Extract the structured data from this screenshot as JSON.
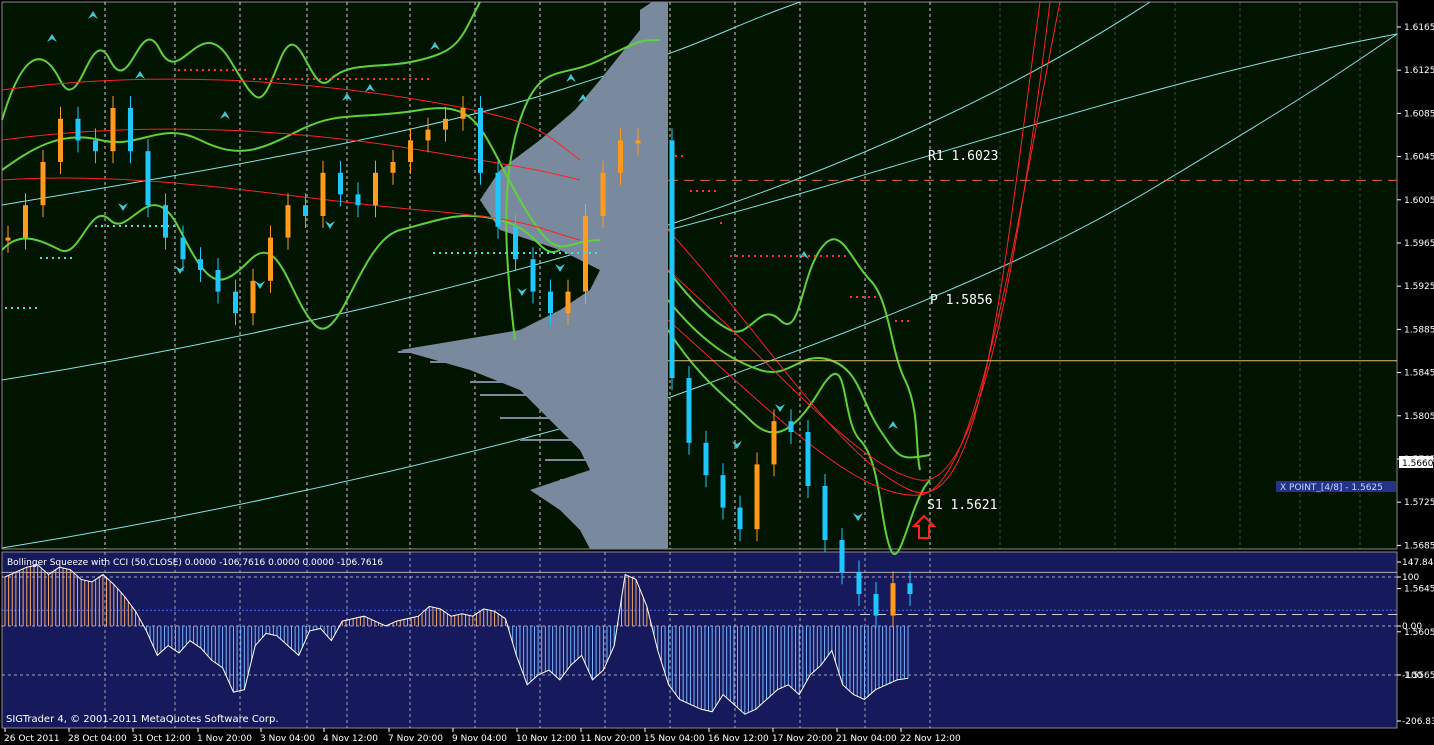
{
  "main_panel": {
    "price_axis_ticks": [
      "1.6165",
      "1.6125",
      "1.6085",
      "1.6045",
      "1.6005",
      "1.5965",
      "1.5925",
      "1.5885",
      "1.5845",
      "1.5805",
      "1.5765",
      "1.5725",
      "1.5685",
      "1.5645",
      "1.5605",
      "1.5565"
    ],
    "current_price": "1.5660",
    "pivot_R1": "R1  1.6023",
    "pivot_P": "P  1.5856",
    "pivot_S1": "S1  1.5621",
    "xpoint_label": "X POINT_[4/8] - 1.5625",
    "colors": {
      "background": "#001400",
      "bull_candle": "#ff9a1e",
      "bear_candle": "#1ec8ff",
      "bands": "#5ed13c",
      "regression": "#ff2020",
      "channel": "#7fe6ec",
      "profile": "#7a8a9e",
      "pivot_line_r1": "#e0603a",
      "pivot_line_p": "#e8c070",
      "arrow": "#ff2020"
    }
  },
  "indicator_panel": {
    "title": "Bollinger Squeeze with CCI (50,CLOSE) 0.0000 -106.7616 0.0000 0.0000 -106.7616",
    "axis_ticks": [
      "147.841",
      "100",
      "0.00",
      "-100",
      "-206.836"
    ],
    "copyright": "SIGTrader 4, © 2001-2011 MetaQuotes Software Corp.",
    "colors": {
      "background": "#161a5c",
      "pos_hist": "#f0a86a",
      "neg_hist": "#7ab4ff",
      "line": "#ffffff"
    }
  },
  "x_axis_labels": [
    "26 Oct 2011",
    "28 Oct 04:00",
    "31 Oct 12:00",
    "1 Nov 20:00",
    "3 Nov 04:00",
    "4 Nov 12:00",
    "7 Nov 20:00",
    "9 Nov 04:00",
    "10 Nov 12:00",
    "11 Nov 20:00",
    "15 Nov 04:00",
    "16 Nov 12:00",
    "17 Nov 20:00",
    "21 Nov 04:00",
    "22 Nov 12:00"
  ],
  "chart_data": {
    "type": "candlestick",
    "symbol_pair_price_range": [
      1.5545,
      1.6185
    ],
    "close_path": [
      1.597,
      1.6,
      1.604,
      1.608,
      1.606,
      1.605,
      1.609,
      1.605,
      1.6,
      1.597,
      1.595,
      1.594,
      1.592,
      1.59,
      1.593,
      1.597,
      1.6,
      1.599,
      1.603,
      1.601,
      1.6,
      1.603,
      1.604,
      1.606,
      1.607,
      1.608,
      1.609,
      1.603,
      1.598,
      1.595,
      1.592,
      1.59,
      1.592,
      1.599,
      1.603,
      1.606,
      1.606,
      1.584,
      1.578,
      1.575,
      1.572,
      1.57,
      1.576,
      1.58,
      1.579,
      1.574,
      1.569,
      1.566,
      1.564,
      1.562,
      1.565,
      1.564
    ],
    "pivots": {
      "R1": 1.6023,
      "P": 1.5856,
      "S1": 1.5621
    },
    "xpoint": 1.5625,
    "last_price": 1.566,
    "indicator": {
      "name": "Bollinger Squeeze with CCI (50,CLOSE)",
      "ylim": [
        -206.836,
        147.841
      ],
      "values": [
        100,
        110,
        120,
        125,
        105,
        120,
        115,
        95,
        90,
        105,
        85,
        60,
        30,
        -10,
        -60,
        -40,
        -55,
        -30,
        -45,
        -70,
        -85,
        -135,
        -130,
        -40,
        -15,
        -20,
        -40,
        -60,
        -10,
        -5,
        -30,
        10,
        15,
        20,
        10,
        0,
        10,
        15,
        20,
        40,
        35,
        20,
        25,
        20,
        35,
        30,
        15,
        -60,
        -120,
        -100,
        -90,
        -110,
        -80,
        -60,
        -110,
        -90,
        -40,
        105,
        95,
        40,
        -50,
        -120,
        -150,
        -160,
        -170,
        -175,
        -140,
        -160,
        -180,
        -170,
        -150,
        -130,
        -120,
        -140,
        -100,
        -80,
        -50,
        -120,
        -140,
        -150,
        -130,
        -120,
        -110,
        -106.7616
      ]
    }
  }
}
